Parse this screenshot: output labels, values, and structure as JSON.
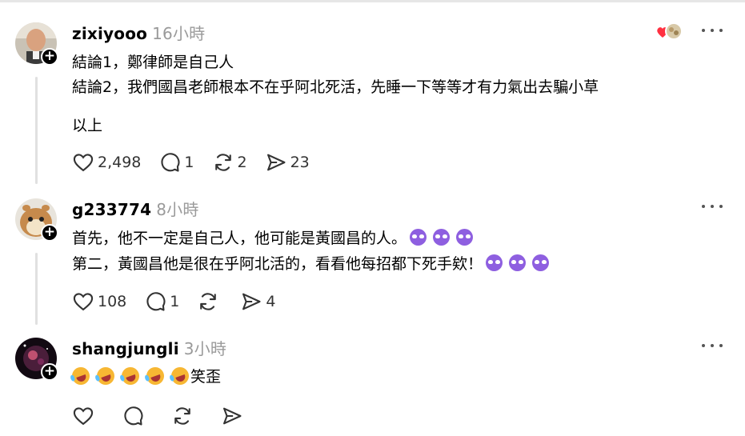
{
  "posts": [
    {
      "username": "zixiyooo",
      "time": "16小時",
      "lines": [
        "結論1，鄭律師是自己人",
        "結論2，我們國昌老師根本不在乎阿北死活，先睡一下等等才有力氣出去騙小草",
        "以上"
      ],
      "likes": "2,498",
      "replies": "1",
      "reposts": "2",
      "shares": "23"
    },
    {
      "username": "g233774",
      "time": "8小時",
      "lines": [
        "首先，他不一定是自己人，他可能是黃國昌的人。",
        "第二，黃國昌他是很在乎阿北活的，看看他每招都下死手欸！"
      ],
      "likes": "108",
      "replies": "1",
      "reposts": "",
      "shares": "4"
    },
    {
      "username": "shangjungli",
      "time": "3小時",
      "lines": [
        "笑歪"
      ],
      "likes": "",
      "replies": "",
      "reposts": "",
      "shares": ""
    }
  ],
  "icons": {
    "more": "more-dots-icon",
    "like": "heart-icon",
    "reply": "comment-icon",
    "repost": "repost-icon",
    "share": "share-icon",
    "follow": "plus-icon"
  },
  "colors": {
    "accent_heart": "#ff3040",
    "muted": "#9a9a9a"
  }
}
